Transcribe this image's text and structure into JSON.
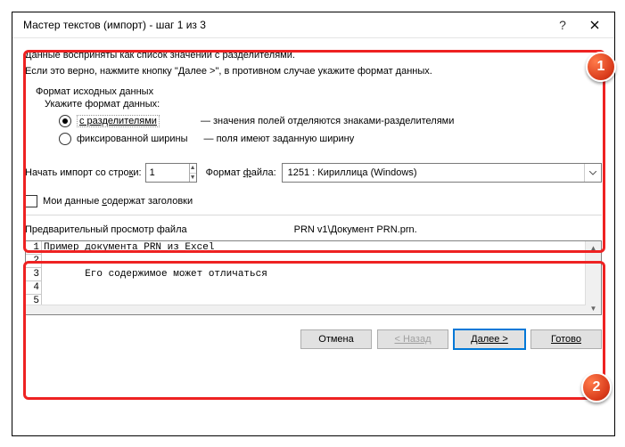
{
  "title": "Мастер текстов (импорт) - шаг 1 из 3",
  "intro1": "Данные восприняты как список значений с разделителями.",
  "intro2": "Если это верно, нажмите кнопку \"Далее >\", в противном случае укажите формат данных.",
  "group": "Формат исходных данных",
  "prompt": "Укажите формат данных:",
  "radio1": {
    "label": "с разделителями",
    "desc": "— значения полей отделяются знаками-разделителями"
  },
  "radio2": {
    "label": "фиксированной ширины",
    "desc": "— поля имеют заданную ширину"
  },
  "start_label_pre": "Начать импорт со стро",
  "start_label_u": "к",
  "start_label_post": "и:",
  "start_value": "1",
  "format_label_pre": "Формат ",
  "format_label_u": "ф",
  "format_label_post": "айла:",
  "format_value": "1251 : Кириллица (Windows)",
  "headers_pre": "Мои данные ",
  "headers_u": "с",
  "headers_post": "одержат заголовки",
  "preview_label": "Предварительный просмотр файла",
  "preview_path": "PRN v1\\Документ PRN.prn.",
  "preview_lines": {
    "l1": "Пример документа PRN из Excel",
    "l3": "       Его содержимое может отличаться"
  },
  "buttons": {
    "cancel": "Отмена",
    "back": "< Назад",
    "next": "Далее >",
    "finish": "Готово"
  }
}
